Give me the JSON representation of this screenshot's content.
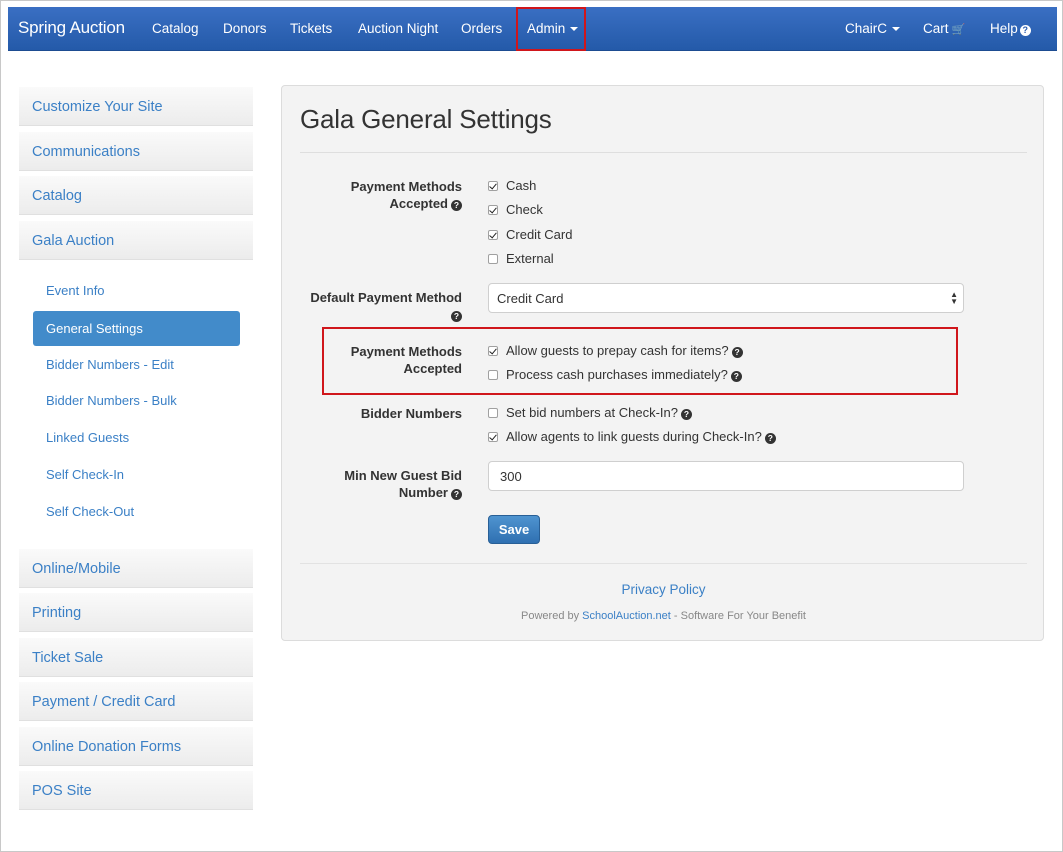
{
  "navbar": {
    "brand": "Spring Auction",
    "items": [
      "Catalog",
      "Donors",
      "Tickets",
      "Auction Night",
      "Orders"
    ],
    "admin": "Admin",
    "user": "ChairC",
    "cart": "Cart",
    "help": "Help",
    "cart_icon": "shopping-cart-icon",
    "help_icon": "question-circle-icon"
  },
  "sidebar": {
    "top_items": [
      "Customize Your Site",
      "Communications",
      "Catalog",
      "Gala Auction"
    ],
    "sub_items": [
      "Event Info",
      "General Settings",
      "Bidder Numbers - Edit",
      "Bidder Numbers - Bulk",
      "Linked Guests",
      "Self Check-In",
      "Self Check-Out"
    ],
    "active_sub": "General Settings",
    "bottom_items": [
      "Online/Mobile",
      "Printing",
      "Ticket Sale",
      "Payment / Credit Card",
      "Online Donation Forms",
      "POS Site"
    ]
  },
  "main": {
    "title": "Gala General Settings",
    "payment_methods": {
      "label_line1": "Payment Methods",
      "label_line2": "Accepted",
      "options": [
        {
          "label": "Cash",
          "checked": true
        },
        {
          "label": "Check",
          "checked": true
        },
        {
          "label": "Credit Card",
          "checked": true
        },
        {
          "label": "External",
          "checked": false
        }
      ]
    },
    "default_payment": {
      "label": "Default Payment Method",
      "value": "Credit Card"
    },
    "payment_methods_2": {
      "label_line1": "Payment Methods",
      "label_line2": "Accepted",
      "options": [
        {
          "label": "Allow guests to prepay cash for items?",
          "checked": true
        },
        {
          "label": "Process cash purchases immediately?",
          "checked": false
        }
      ]
    },
    "bidder_numbers": {
      "label": "Bidder Numbers",
      "options": [
        {
          "label": "Set bid numbers at Check-In?",
          "checked": false
        },
        {
          "label": "Allow agents to link guests during Check-In?",
          "checked": true
        }
      ]
    },
    "min_guest_bid": {
      "label_line1": "Min New Guest Bid",
      "label_line2": "Number",
      "value": "300"
    },
    "save_label": "Save"
  },
  "footer": {
    "privacy": "Privacy Policy",
    "powered_prefix": "Powered by ",
    "powered_link": "SchoolAuction.net",
    "powered_suffix": " - Software For Your Benefit"
  },
  "colors": {
    "navbar": "#2a5db0",
    "link": "#3b80c6",
    "active": "#428bca",
    "highlight": "#d0161b"
  }
}
